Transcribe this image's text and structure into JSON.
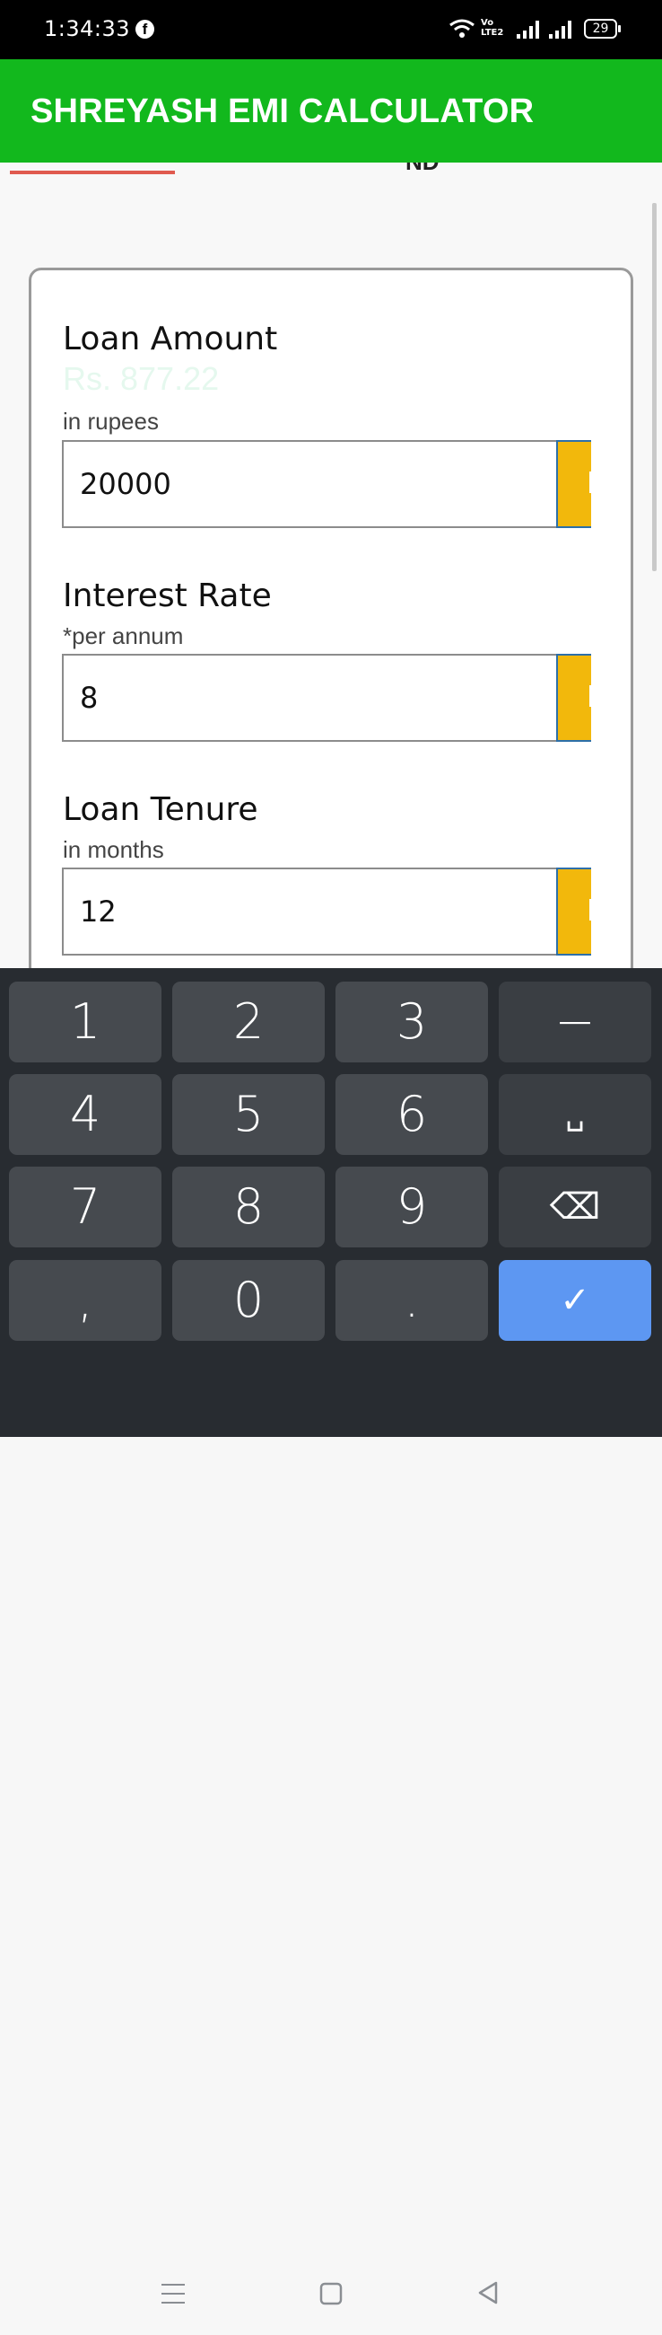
{
  "status_bar": {
    "time": "1:34:33",
    "battery": "29",
    "volte_top": "Vo",
    "volte_bottom": "LTE2"
  },
  "app_bar": {
    "title": "SHREYASH EMI CALCULATOR"
  },
  "tabs": {
    "peek_label": "ND"
  },
  "result": {
    "value": "Rs. 877.22"
  },
  "form": {
    "loan_amount": {
      "label": "Loan Amount",
      "sub": "in rupees",
      "value": "20000"
    },
    "interest_rate": {
      "label": "Interest Rate",
      "sub": "*per annum",
      "value": "8"
    },
    "loan_tenure": {
      "label": "Loan Tenure",
      "sub": "in months",
      "value": "12"
    }
  },
  "keyboard": {
    "keys": [
      "1",
      "2",
      "3",
      "−",
      "4",
      "5",
      "6",
      "␣",
      "7",
      "8",
      "9",
      "⌫",
      ",",
      "0",
      ".",
      "✓"
    ]
  },
  "colors": {
    "app_bar": "#12b81d",
    "slider": "#f2b80c",
    "ok_key": "#5d97f2",
    "tab_indicator": "#e05a4f"
  }
}
